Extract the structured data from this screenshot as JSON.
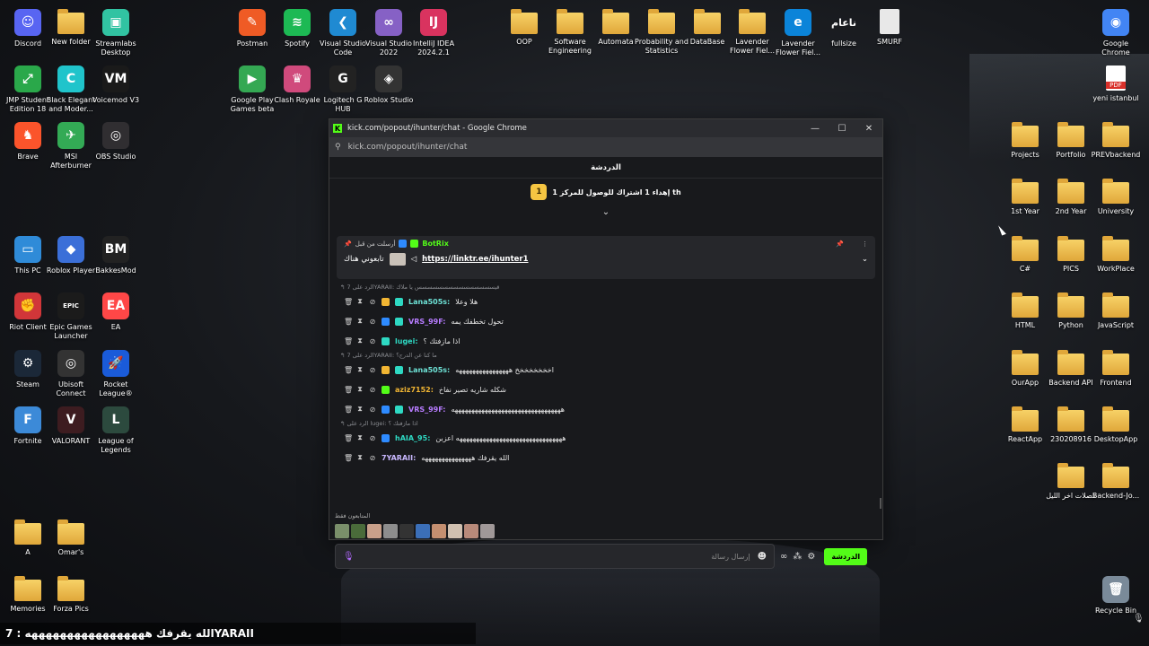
{
  "desktop": {
    "icons": [
      {
        "label": "Discord",
        "icon": "discord-icon",
        "color": "#5865f2",
        "glyph": "☺"
      },
      {
        "label": "New folder",
        "icon": "folder-icon",
        "type": "folder"
      },
      {
        "label": "Streamlabs Desktop",
        "icon": "streamlabs-icon",
        "color": "#31c3a2",
        "glyph": "▣"
      },
      {
        "label": "Postman",
        "icon": "postman-icon",
        "color": "#ef5b25",
        "glyph": "✎"
      },
      {
        "label": "Spotify",
        "icon": "spotify-icon",
        "color": "#1db954",
        "glyph": "≋"
      },
      {
        "label": "Visual Studio Code",
        "icon": "vscode-icon",
        "color": "#1f8ad2",
        "glyph": "❮"
      },
      {
        "label": "Visual Studio 2022",
        "icon": "visual-studio-icon",
        "color": "#8661c5",
        "glyph": "∞"
      },
      {
        "label": "IntelliJ IDEA 2024.2.1",
        "icon": "intellij-icon",
        "color": "#d9335f",
        "glyph": "IJ"
      },
      {
        "label": "OOP",
        "icon": "folder-icon",
        "type": "folder"
      },
      {
        "label": "Software Engineering",
        "icon": "folder-icon",
        "type": "folder"
      },
      {
        "label": "Automata",
        "icon": "folder-icon",
        "type": "folder"
      },
      {
        "label": "Probability and Statistics",
        "icon": "folder-icon",
        "type": "folder"
      },
      {
        "label": "DataBase",
        "icon": "folder-icon",
        "type": "folder"
      },
      {
        "label": "Lavender Flower Fiel...",
        "icon": "folder-icon",
        "type": "folder"
      },
      {
        "label": "Lavender Flower Fiel...",
        "icon": "edge-icon",
        "color": "#0b84d9",
        "glyph": "e"
      },
      {
        "label": "fullsize",
        "icon": "image-icon",
        "type": "text",
        "glyph": "ناعام"
      },
      {
        "label": "SMURF",
        "icon": "document-icon",
        "type": "doc"
      },
      {
        "label": "Google Chrome",
        "icon": "chrome-icon",
        "color": "#4285f4",
        "glyph": "◉"
      },
      {
        "label": "JMP Student Edition 18",
        "icon": "jmp-icon",
        "color": "#2aa84a",
        "glyph": "⤢"
      },
      {
        "label": "Black Elegant and Moder...",
        "icon": "canva-icon",
        "color": "#20c4cb",
        "glyph": "C"
      },
      {
        "label": "Voicemod V3",
        "icon": "voicemod-icon",
        "color": "#1a1a1a",
        "glyph": "VM"
      },
      {
        "label": "Google Play Games beta",
        "icon": "google-play-games-icon",
        "color": "#34a853",
        "glyph": "▶"
      },
      {
        "label": "Clash Royale",
        "icon": "clash-royale-icon",
        "color": "#d04a7c",
        "glyph": "♛"
      },
      {
        "label": "Logitech G HUB",
        "icon": "logitech-icon",
        "color": "#222",
        "glyph": "G"
      },
      {
        "label": "Roblox Studio",
        "icon": "roblox-studio-icon",
        "color": "#333",
        "glyph": "◈"
      },
      {
        "label": "yeni istanbul",
        "icon": "pdf-icon",
        "type": "pdf"
      },
      {
        "label": "Brave",
        "icon": "brave-icon",
        "color": "#fb542b",
        "glyph": "♞"
      },
      {
        "label": "MSI Afterburner",
        "icon": "msi-icon",
        "color": "#3a5",
        "glyph": "✈"
      },
      {
        "label": "OBS Studio",
        "icon": "obs-icon",
        "color": "#302e31",
        "glyph": "◎"
      },
      {
        "label": "Projects",
        "icon": "folder-icon",
        "type": "folder"
      },
      {
        "label": "Portfolio",
        "icon": "folder-icon",
        "type": "folder"
      },
      {
        "label": "PREVbackend",
        "icon": "folder-icon",
        "type": "folder"
      },
      {
        "label": "1st Year",
        "icon": "folder-icon",
        "type": "folder"
      },
      {
        "label": "2nd Year",
        "icon": "folder-icon",
        "type": "folder"
      },
      {
        "label": "University",
        "icon": "folder-icon",
        "type": "folder"
      },
      {
        "label": "This PC",
        "icon": "this-pc-icon",
        "color": "#2f8bd8",
        "glyph": "▭"
      },
      {
        "label": "Roblox Player",
        "icon": "roblox-icon",
        "color": "#3b6fd8",
        "glyph": "◆"
      },
      {
        "label": "BakkesMod",
        "icon": "bakkesmod-icon",
        "color": "#222",
        "glyph": "BM"
      },
      {
        "label": "C#",
        "icon": "folder-icon",
        "type": "folder"
      },
      {
        "label": "PICS",
        "icon": "folder-icon",
        "type": "folder"
      },
      {
        "label": "WorkPlace",
        "icon": "folder-icon",
        "type": "folder"
      },
      {
        "label": "Riot Client",
        "icon": "riot-icon",
        "color": "#d13639",
        "glyph": "✊"
      },
      {
        "label": "Epic Games Launcher",
        "icon": "epic-games-icon",
        "color": "#1b1b1b",
        "glyph": "EPIC"
      },
      {
        "label": "EA",
        "icon": "ea-icon",
        "color": "#ff4747",
        "glyph": "EA"
      },
      {
        "label": "HTML",
        "icon": "folder-icon",
        "type": "folder"
      },
      {
        "label": "Python",
        "icon": "folder-icon",
        "type": "folder"
      },
      {
        "label": "JavaScript",
        "icon": "folder-icon",
        "type": "folder"
      },
      {
        "label": "Steam",
        "icon": "steam-icon",
        "color": "#1b2838",
        "glyph": "⚙"
      },
      {
        "label": "Ubisoft Connect",
        "icon": "ubisoft-icon",
        "color": "#333",
        "glyph": "◎"
      },
      {
        "label": "Rocket League®",
        "icon": "rocket-league-icon",
        "color": "#1a5bd9",
        "glyph": "🚀"
      },
      {
        "label": "OurApp",
        "icon": "folder-icon",
        "type": "folder"
      },
      {
        "label": "Backend API",
        "icon": "folder-icon",
        "type": "folder"
      },
      {
        "label": "Frontend",
        "icon": "folder-icon",
        "type": "folder"
      },
      {
        "label": "Fortnite",
        "icon": "fortnite-icon",
        "color": "#3c8ad8",
        "glyph": "F"
      },
      {
        "label": "VALORANT",
        "icon": "valorant-icon",
        "color": "#3d1c20",
        "glyph": "V"
      },
      {
        "label": "League of Legends",
        "icon": "league-icon",
        "color": "#2c4a3e",
        "glyph": "L"
      },
      {
        "label": "ReactApp",
        "icon": "folder-icon",
        "type": "folder"
      },
      {
        "label": "230208916",
        "icon": "folder-icon",
        "type": "folder"
      },
      {
        "label": "DesktopApp",
        "icon": "folder-icon",
        "type": "folder"
      },
      {
        "label": "فصلات اخر الليل",
        "icon": "folder-icon",
        "type": "folder"
      },
      {
        "label": "Backend-Jo...",
        "icon": "folder-icon",
        "type": "folder"
      },
      {
        "label": "A",
        "icon": "folder-icon",
        "type": "folder"
      },
      {
        "label": "Omar's",
        "icon": "folder-icon",
        "type": "folder"
      },
      {
        "label": "Memories",
        "icon": "folder-icon",
        "type": "folder"
      },
      {
        "label": "Forza Pics",
        "icon": "folder-icon",
        "type": "folder"
      },
      {
        "label": "Recycle Bin",
        "icon": "recycle-bin-icon",
        "color": "#7a8a99",
        "glyph": "🗑"
      }
    ]
  },
  "window": {
    "title": "kick.com/popout/ihunter/chat - Google Chrome",
    "url": "kick.com/popout/ihunter/chat",
    "minimize": "—",
    "maximize": "☐",
    "close": "✕"
  },
  "chat": {
    "header": "الدردشة",
    "goal_rank": "1",
    "goal_text": "إهداء 1 اشتراك للوصول للمركز 1 th",
    "pinned": {
      "pinned_by": "أرسلت من قبل",
      "author": "BotRix",
      "message_prefix": "تابعوني هناك",
      "link": "https://linktr.ee/ihunter1"
    },
    "messages": [
      {
        "reply": "الرد على 7YARAII: قيسسسسسسسسسسسسسسس يا ملاك",
        "user": "Lana505s",
        "user_color": "#6ee3d7",
        "badges": [
          "b-gold",
          "b-teal"
        ],
        "text": "هلا وعلا"
      },
      {
        "reply": "",
        "user": "VRS_99F",
        "user_color": "#b77cff",
        "badges": [
          "b-blue",
          "b-teal"
        ],
        "text": "تحول تخطفك يمه"
      },
      {
        "reply": "",
        "user": "lugei",
        "user_color": "#2ed9c3",
        "badges": [
          "b-teal"
        ],
        "text": "اذا مازفتك ؟"
      },
      {
        "reply": "الرد على 7YARAII: ما كنا عن الدرج؟",
        "user": "Lana505s",
        "user_color": "#6ee3d7",
        "badges": [
          "b-gold",
          "b-teal"
        ],
        "text": "اخخخخخخخخ ههههههههههههههههه"
      },
      {
        "reply": "",
        "user": "aziz7152",
        "user_color": "#f2b633",
        "badges": [
          "b-green"
        ],
        "text": "شكله شاريه تصير نفاخ"
      },
      {
        "reply": "",
        "user": "VRS_99F",
        "user_color": "#b77cff",
        "badges": [
          "b-blue",
          "b-teal"
        ],
        "text": "هههههههههههههههههههههههههههههههههه"
      },
      {
        "reply": "الرد على lugei: اذا مازفتك ؟",
        "user": "hAIA_95",
        "user_color": "#2ed9c3",
        "badges": [
          "b-blue"
        ],
        "text": "ههههههههههههههههههههههههههههههههه اعزبن"
      },
      {
        "reply": "",
        "user": "7YARAII",
        "user_color": "#c9b8ff",
        "badges": [],
        "text": "الله يقرفك هههههههههههههههه"
      }
    ],
    "subscribers_label": "المتابعون فقط",
    "input_placeholder": "إرسال رسالة",
    "send_label": "الدردشة"
  },
  "caption": "الله يقرفك هههههههههههههههههه : 7YARAII"
}
